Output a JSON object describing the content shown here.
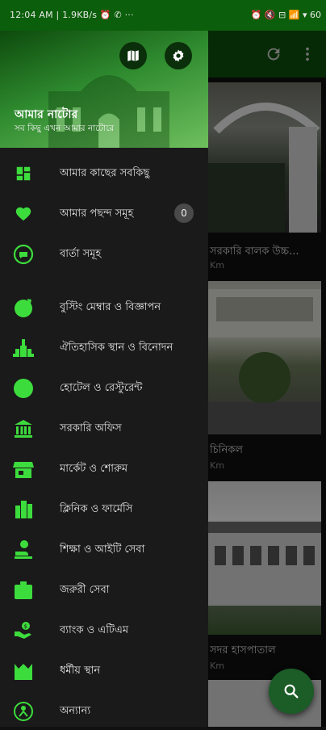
{
  "status_bar": {
    "left_text": "12:04 AM | 1.9KB/s ⏰ ✆ ···",
    "right_text": "⏰ 🔇 ⊟ 📶 ▾ 60"
  },
  "drawer": {
    "title": "আমার নাটোর",
    "subtitle": "সব কিছু এখন আমার নাটোরে",
    "items": [
      {
        "label": "আমার কাছের সবকিছু",
        "icon": "dashboard-icon"
      },
      {
        "label": "আমার পছন্দ সমূহ",
        "icon": "heart-icon",
        "badge": "0"
      },
      {
        "label": "বার্তা সমূহ",
        "icon": "chat-icon"
      },
      {
        "label": "বুস্টিং মেম্বার ও বিজ্ঞাপন",
        "icon": "rocket-icon"
      },
      {
        "label": "ঐতিহাসিক স্থান ও বিনোদন",
        "icon": "monument-icon"
      },
      {
        "label": "হোটেল ও রেস্টুরেন্ট",
        "icon": "hotel-icon"
      },
      {
        "label": "সরকারি অফিস",
        "icon": "government-icon"
      },
      {
        "label": "মার্কেট ও শোরুম",
        "icon": "store-icon"
      },
      {
        "label": "ক্লিনিক ও ফার্মেসি",
        "icon": "clinic-icon"
      },
      {
        "label": "শিক্ষা ও আইটি সেবা",
        "icon": "education-icon"
      },
      {
        "label": "জরুরী সেবা",
        "icon": "emergency-icon"
      },
      {
        "label": "ব্যাংক ও এটিএম",
        "icon": "bank-icon"
      },
      {
        "label": "ধর্মীয় স্থান",
        "icon": "mosque-icon"
      },
      {
        "label": "অন্যান্য",
        "icon": "other-icon"
      }
    ]
  },
  "list": {
    "cards": [
      {
        "title": "সরকারি বালক উচ্চ...",
        "sub": "Km"
      },
      {
        "title": "চিনিকল",
        "sub": "Km"
      },
      {
        "title": "সদর হাসপাতাল",
        "sub": "Km"
      }
    ]
  },
  "colors": {
    "accent": "#3ddc3d",
    "primary_dark": "#0b5e0b",
    "drawer_bg": "#1a1a1a"
  }
}
